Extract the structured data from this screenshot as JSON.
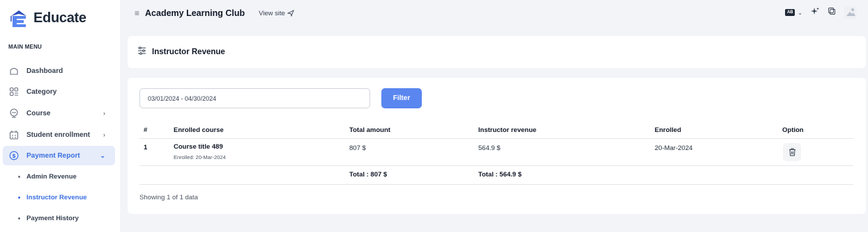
{
  "app": {
    "logo_text": "Educate",
    "brand_color": "#3b6fe0"
  },
  "sidebar": {
    "menu_title": "MAIN MENU",
    "items": [
      {
        "label": "Dashboard",
        "icon": "home-icon"
      },
      {
        "label": "Category",
        "icon": "category-icon"
      },
      {
        "label": "Course",
        "icon": "course-icon"
      },
      {
        "label": "Student enrollment",
        "icon": "student-icon"
      },
      {
        "label": "Payment Report",
        "icon": "dollar-circle-icon"
      }
    ],
    "sub_items": [
      {
        "label": "Admin Revenue"
      },
      {
        "label": "Instructor Revenue"
      },
      {
        "label": "Payment History"
      }
    ]
  },
  "topbar": {
    "site_title": "Academy Learning Club",
    "view_site": "View site",
    "lang_badge": "AB"
  },
  "page": {
    "title": "Instructor Revenue"
  },
  "filter": {
    "date_range": "03/01/2024 - 04/30/2024",
    "button_label": "Filter"
  },
  "table": {
    "headers": [
      "#",
      "Enrolled course",
      "Total amount",
      "Instructor revenue",
      "Enrolled",
      "Option"
    ],
    "rows": [
      {
        "index": "1",
        "course_title": "Course title 489",
        "course_enrolled": "Enrolled: 20-Mar-2024",
        "total_amount": "807 $",
        "instructor_revenue": "564.9 $",
        "enrolled": "20-Mar-2024"
      }
    ],
    "totals": {
      "total_amount": "Total : 807 $",
      "instructor_revenue": "Total : 564.9 $"
    },
    "showing": "Showing 1 of 1 data"
  }
}
